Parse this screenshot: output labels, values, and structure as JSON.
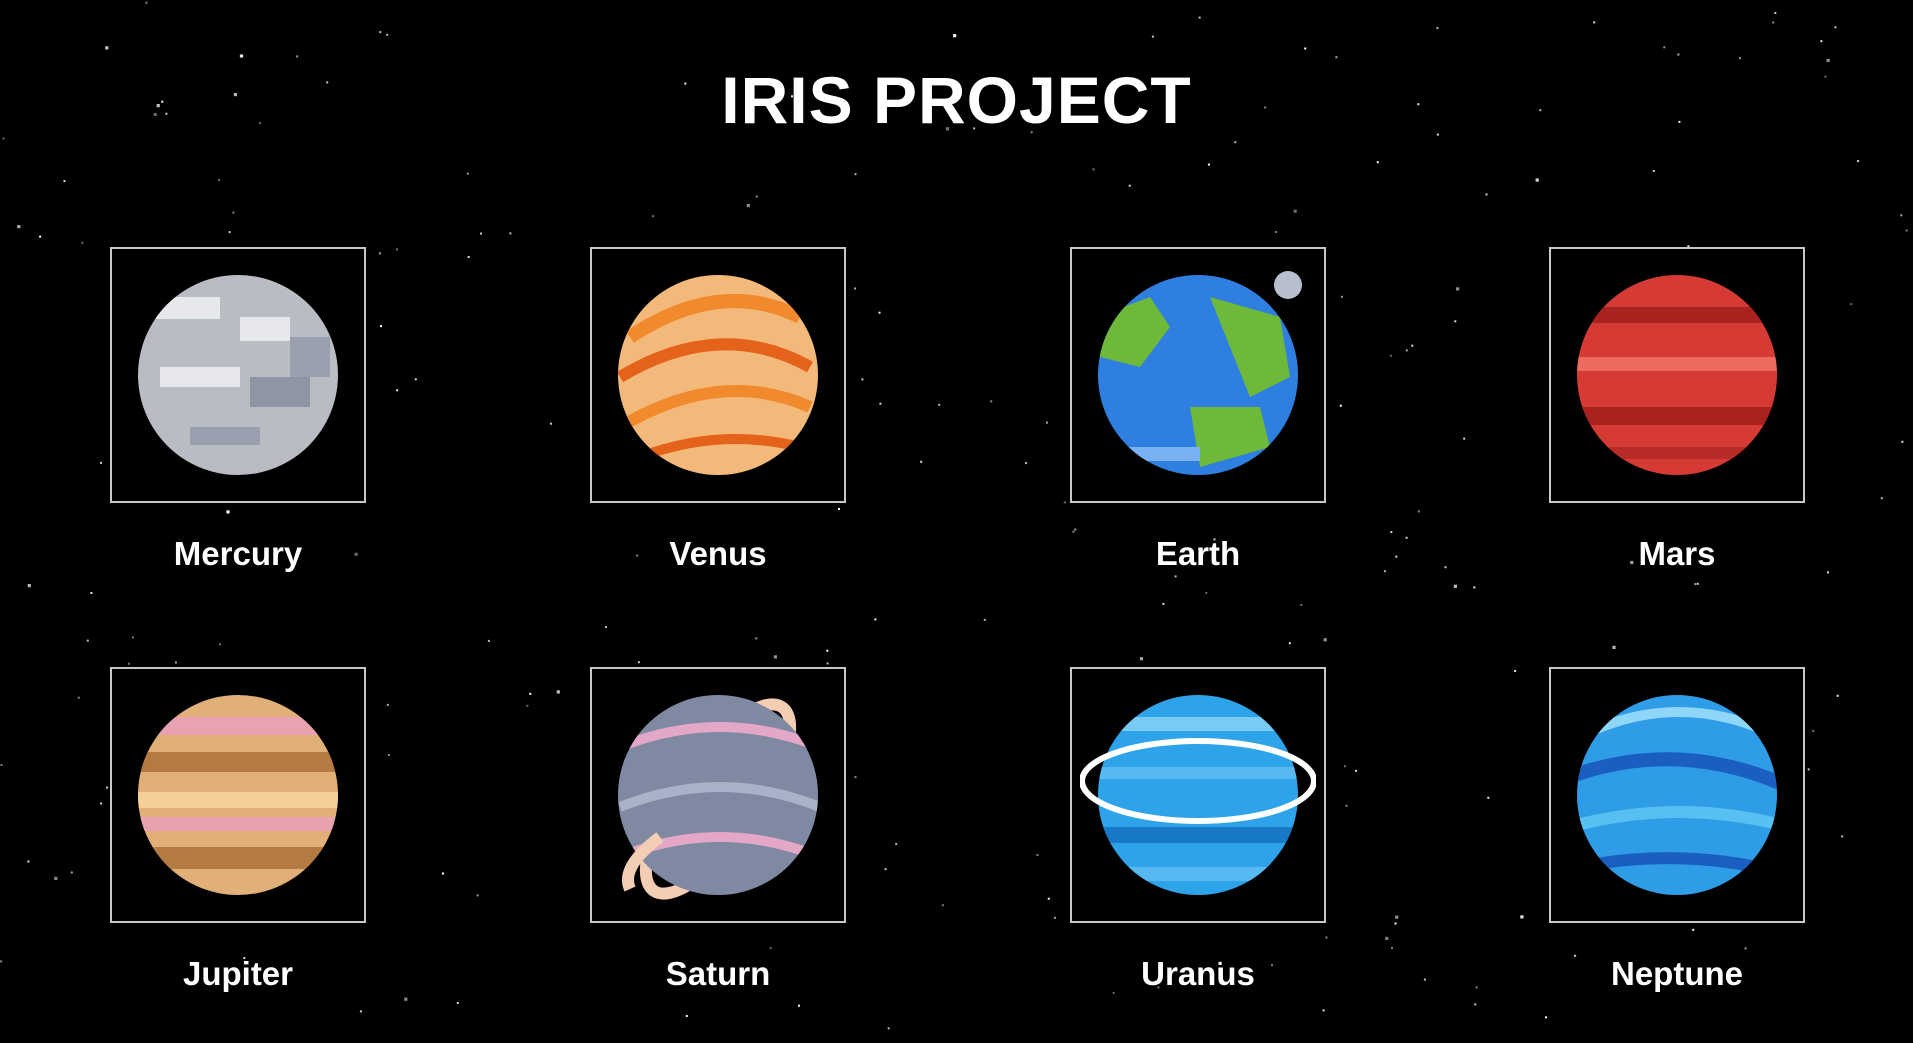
{
  "title": "IRIS PROJECT",
  "planets": [
    {
      "name": "Mercury",
      "icon": "mercury-icon",
      "colors": {
        "base": "#b9bcc3",
        "dark": "#8f95a3",
        "light": "#e6e8ec",
        "band": "#9aa0ad"
      }
    },
    {
      "name": "Venus",
      "icon": "venus-icon",
      "colors": {
        "base": "#f3b97a",
        "dark": "#e4621a",
        "light": "#f8d6a6",
        "band": "#f08a2c"
      }
    },
    {
      "name": "Earth",
      "icon": "earth-icon",
      "colors": {
        "base": "#2f7fe0",
        "dark": "#1f5fb8",
        "light": "#79b2f2",
        "band": "#6fb93a"
      }
    },
    {
      "name": "Mars",
      "icon": "mars-icon",
      "colors": {
        "base": "#d63a34",
        "dark": "#a8221e",
        "light": "#ec6a60",
        "band": "#b82c28"
      }
    },
    {
      "name": "Jupiter",
      "icon": "jupiter-icon",
      "colors": {
        "base": "#e0b078",
        "dark": "#b37a42",
        "light": "#f4cf9a",
        "band": "#e8a2b0"
      }
    },
    {
      "name": "Saturn",
      "icon": "saturn-icon",
      "colors": {
        "base": "#7f8aa2",
        "dark": "#5d6680",
        "light": "#a9b2c6",
        "band": "#e3a7c7",
        "ring": "#f3cdb4"
      }
    },
    {
      "name": "Uranus",
      "icon": "uranus-icon",
      "colors": {
        "base": "#2ea3ea",
        "dark": "#1779c8",
        "light": "#79cbf5",
        "band": "#56b9ef",
        "ring": "#ffffff"
      }
    },
    {
      "name": "Neptune",
      "icon": "neptune-icon",
      "colors": {
        "base": "#2e9ce6",
        "dark": "#1a5fc0",
        "light": "#8fd6f8",
        "band": "#56c0f0"
      }
    }
  ]
}
